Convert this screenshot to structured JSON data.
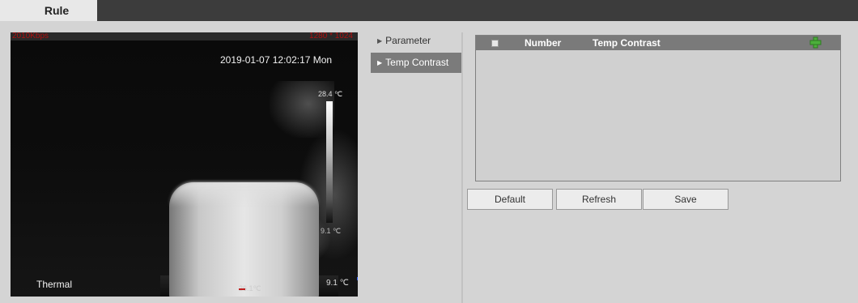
{
  "tabs": {
    "rule": "Rule"
  },
  "video": {
    "bitrate": "2010Kbps",
    "resolution": "1280 * 1024",
    "timestamp": "2019-01-07 12:02:17 Mon",
    "temp_max": "28.4 ℃",
    "temp_min": "9.1 ℃",
    "spot_temp": "9.1 ℃",
    "center_label": "26.1℃",
    "channel_name": "Thermal"
  },
  "menu": {
    "items": [
      {
        "label": "Parameter",
        "active": false
      },
      {
        "label": "Temp Contrast",
        "active": true
      }
    ]
  },
  "table": {
    "columns": [
      "Number",
      "Temp Contrast"
    ],
    "rows": []
  },
  "buttons": {
    "default": "Default",
    "refresh": "Refresh",
    "save": "Save"
  },
  "icons": {
    "add": "plus-icon",
    "menu_arrow": "triangle-right-icon"
  },
  "colors": {
    "top_bar": "#3c3c3c",
    "menu_active": "#7b7b7b",
    "table_header": "#7a7a7a",
    "add_icon": "#4caf3c",
    "overlay_red": "#b01010"
  }
}
